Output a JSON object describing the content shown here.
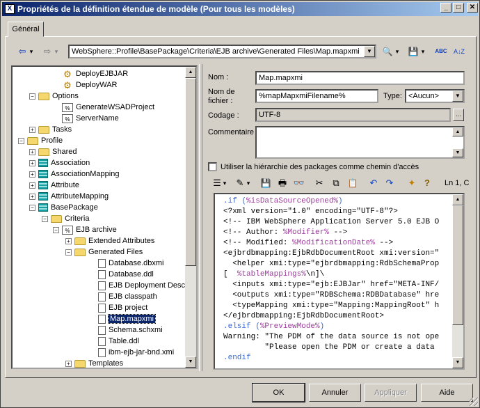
{
  "window": {
    "title": "Propriétés de la définition étendue de modèle (Pour tous les modèles)",
    "app_icon": "X",
    "controls": {
      "minimize": "_",
      "maximize": "□",
      "close": "✕"
    }
  },
  "tabs": [
    {
      "label": "Général"
    }
  ],
  "toolbar": {
    "back_icon": "⇦",
    "back_drop": "▾",
    "forward_icon": "⇨",
    "forward_drop": "▾",
    "path": "WebSphere::Profile\\BasePackage\\Criteria\\EJB archive\\Generated Files\\Map.mapxmi",
    "path_drop": "▼",
    "find_icon": "🔍",
    "find_drop": "▾",
    "save_icon": "💾",
    "save_drop": "▾",
    "spell_icon": "ABC",
    "sort_icon": "A↓Z"
  },
  "tree": {
    "items": [
      {
        "label": "DeployEJBJAR",
        "icon": "gear",
        "expander": ""
      },
      {
        "label": "DeployWAR",
        "icon": "gear",
        "expander": ""
      },
      {
        "label": "Options",
        "icon": "folder",
        "expander": "−"
      },
      {
        "label": "GenerateWSADProject",
        "icon": "generation-template",
        "icon_text": "%",
        "expander": ""
      },
      {
        "label": "ServerName",
        "icon": "generation-template",
        "icon_text": "%",
        "expander": ""
      },
      {
        "label": "Tasks",
        "icon": "folder",
        "expander": "+"
      },
      {
        "label": "Profile",
        "icon": "folder",
        "expander": "−"
      },
      {
        "label": "Shared",
        "icon": "folder",
        "expander": "+"
      },
      {
        "label": "Association",
        "icon": "table",
        "expander": "+"
      },
      {
        "label": "AssociationMapping",
        "icon": "table",
        "expander": "+"
      },
      {
        "label": "Attribute",
        "icon": "table",
        "expander": "+"
      },
      {
        "label": "AttributeMapping",
        "icon": "table",
        "expander": "+"
      },
      {
        "label": "BasePackage",
        "icon": "table",
        "expander": "−"
      },
      {
        "label": "Criteria",
        "icon": "folder",
        "expander": "−"
      },
      {
        "label": "EJB archive",
        "icon": "generation-template",
        "icon_text": "%",
        "expander": "−"
      },
      {
        "label": "Extended Attributes",
        "icon": "folder",
        "expander": "+"
      },
      {
        "label": "Generated Files",
        "icon": "folder",
        "expander": "−"
      },
      {
        "label": "Database.dbxmi",
        "icon": "file",
        "expander": ""
      },
      {
        "label": "Database.ddl",
        "icon": "file",
        "expander": ""
      },
      {
        "label": "EJB Deployment Descrip",
        "icon": "file",
        "expander": ""
      },
      {
        "label": "EJB classpath",
        "icon": "file",
        "expander": ""
      },
      {
        "label": "EJB project",
        "icon": "file",
        "expander": ""
      },
      {
        "label": "Map.mapxmi",
        "icon": "file",
        "expander": "",
        "selected": true
      },
      {
        "label": "Schema.schxmi",
        "icon": "file",
        "expander": ""
      },
      {
        "label": "Table.ddl",
        "icon": "file",
        "expander": ""
      },
      {
        "label": "ibm-ejb-jar-bnd.xmi",
        "icon": "file",
        "expander": ""
      },
      {
        "label": "Templates",
        "icon": "folder",
        "expander": "+"
      }
    ],
    "scroll": {
      "up": "▲",
      "down": "▼",
      "left": "◀",
      "right": "▶"
    }
  },
  "form": {
    "name_label": "Nom :",
    "name_value": "Map.mapxmi",
    "filename_label_1": "Nom de",
    "filename_label_2": "fichier :",
    "filename_value": "%mapMapxmiFilename%",
    "type_label": "Type:",
    "type_value": "<Aucun>",
    "type_drop": "▼",
    "encoding_label": "Codage :",
    "encoding_value": "UTF-8",
    "encoding_button": "...",
    "comment_label": "Commentaire :",
    "comment_value": "",
    "comment_scroll_up": "▲",
    "comment_scroll_down": "▼",
    "use_hierarchy_label": "Utiliser la hiérarchie des packages comme chemin d'accès",
    "use_hierarchy_checked": false
  },
  "editor_toolbar": {
    "properties_icon": "☰",
    "properties_drop": "▾",
    "edit_icon": "✎",
    "edit_drop": "▾",
    "save_icon": "💾",
    "print_icon": "🖶",
    "find_icon": "👓",
    "cut_icon": "✂",
    "copy_icon": "⧉",
    "paste_icon": "📋",
    "undo_icon": "↶",
    "redo_icon": "↷",
    "insert_icon": "✦",
    "help_icon": "?",
    "position": "Ln 1, C"
  },
  "editor": {
    "lines": [
      [
        {
          "t": ".if (",
          "c": "kw"
        },
        {
          "t": "%isDataSourceOpened%",
          "c": "vr"
        },
        {
          "t": ")",
          "c": "kw"
        }
      ],
      [
        {
          "t": "<?xml version=\"1.0\" encoding=\"UTF-8\"?>",
          "c": ""
        }
      ],
      [
        {
          "t": "<!-- IBM WebSphere Application Server 5.0 EJB O",
          "c": ""
        }
      ],
      [
        {
          "t": "<!-- Author: ",
          "c": ""
        },
        {
          "t": "%Modifier%",
          "c": "vr"
        },
        {
          "t": " -->",
          "c": ""
        }
      ],
      [
        {
          "t": "<!-- Modified: ",
          "c": ""
        },
        {
          "t": "%ModificationDate%",
          "c": "vr"
        },
        {
          "t": " -->",
          "c": ""
        }
      ],
      [
        {
          "t": "<ejbrdbmapping:EjbRdbDocumentRoot xmi:version=\"",
          "c": ""
        }
      ],
      [
        {
          "t": "  <helper xmi:type=\"ejbrdbmapping:RdbSchemaProp",
          "c": ""
        }
      ],
      [
        {
          "t": "[  ",
          "c": ""
        },
        {
          "t": "%tableMappings%",
          "c": "vr"
        },
        {
          "t": "\\n]\\",
          "c": ""
        }
      ],
      [
        {
          "t": "  <inputs xmi:type=\"ejb:EJBJar\" href=\"META-INF/",
          "c": ""
        }
      ],
      [
        {
          "t": "  <outputs xmi:type=\"RDBSchema:RDBDatabase\" hre",
          "c": ""
        }
      ],
      [
        {
          "t": "  <typeMapping xmi:type=\"Mapping:MappingRoot\" h",
          "c": ""
        }
      ],
      [
        {
          "t": "</ejbrdbmapping:EjbRdbDocumentRoot>",
          "c": ""
        }
      ],
      [
        {
          "t": ".elsif (",
          "c": "kw"
        },
        {
          "t": "%PreviewMode%",
          "c": "vr"
        },
        {
          "t": ")",
          "c": "kw"
        }
      ],
      [
        {
          "t": "Warning: \"The PDM of the data source is not ope",
          "c": ""
        }
      ],
      [
        {
          "t": "         \"Please open the PDM or create a data",
          "c": ""
        }
      ],
      [
        {
          "t": ".endif",
          "c": "kw"
        }
      ]
    ],
    "scroll": {
      "up": "▲",
      "down": "▼"
    }
  },
  "buttons": {
    "ok": "OK",
    "cancel": "Annuler",
    "apply": "Appliquer",
    "help": "Aide"
  },
  "colors": {
    "title_start": "#0a246a",
    "title_end": "#a6caf0",
    "selection": "#0a246a",
    "keyword": "#3a6ad0",
    "variable": "#9b3e9b"
  }
}
